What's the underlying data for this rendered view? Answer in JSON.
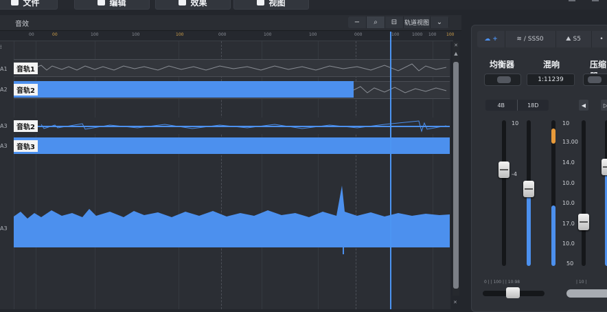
{
  "menu": [
    {
      "label": "文件",
      "icon": "file-icon"
    },
    {
      "label": "编辑",
      "icon": "edit-icon"
    },
    {
      "label": "效果",
      "icon": "effects-icon"
    },
    {
      "label": "视图",
      "icon": "view-icon"
    }
  ],
  "toolbar": {
    "section_label": "音效",
    "buttons": [
      {
        "label": "−",
        "icon": "minus-icon"
      },
      {
        "label": "⌕",
        "icon": "zoom-icon"
      },
      {
        "label": "⊟",
        "icon": "layout-icon"
      },
      {
        "label": "轨道视图",
        "icon": "track-view-icon"
      },
      {
        "label": "⌄",
        "icon": "chevron-down-icon"
      }
    ]
  },
  "ruler": {
    "ticks": [
      "00",
      "00",
      "100",
      "100",
      "100",
      "000",
      "100",
      "100",
      "000",
      "100",
      "1000",
      "100",
      "100"
    ],
    "highlight": [
      1,
      4,
      12
    ]
  },
  "tracks": {
    "row_labels": [
      "A1",
      "A2",
      "A3",
      "A3",
      "A3"
    ],
    "clips": [
      {
        "name": "音轨1",
        "style": "gray"
      },
      {
        "name": "音轨2",
        "style": "blue"
      },
      {
        "name": "音轨2",
        "style": "wave"
      },
      {
        "name": "音轨3",
        "style": "blue"
      }
    ]
  },
  "panel": {
    "tabs": [
      {
        "label": "+",
        "icon": "cloud-icon",
        "active": true
      },
      {
        "label": "/ SSS0",
        "icon": "wifi-icon",
        "active": false
      },
      {
        "label": "S5",
        "icon": "mountain-icon",
        "active": false
      },
      {
        "label": "•",
        "icon": "more-icon",
        "active": false
      }
    ],
    "sections": [
      "均衡器",
      "混响",
      "压缩器"
    ],
    "reverb_readout": "1:11239",
    "segment": [
      "4B",
      "18D"
    ],
    "square_buttons": [
      "◀",
      "▷"
    ],
    "fader_scale_top": "10",
    "fader_scale_mid": "-4",
    "right_scale": [
      "10",
      "13.00",
      "14.0",
      "10.0",
      "10.0",
      "17.0",
      "10.0",
      "50"
    ],
    "bottom_scale_left": "0 | | 100 | | 10:98",
    "bottom_scale_right": "| 10 |",
    "accent": "#4c90ee",
    "accent_orange": "#e89a3a"
  }
}
